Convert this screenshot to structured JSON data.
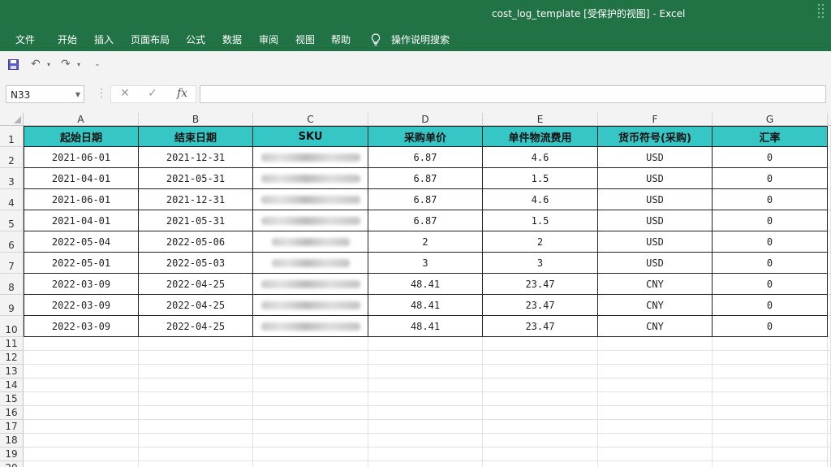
{
  "window": {
    "title": "cost_log_template  [受保护的视图]  -  Excel"
  },
  "menu": [
    "文件",
    "开始",
    "插入",
    "页面布局",
    "公式",
    "数据",
    "审阅",
    "视图",
    "帮助"
  ],
  "search": {
    "label": "操作说明搜索"
  },
  "name_box": {
    "value": "N33"
  },
  "formula_bar": {
    "fx": "fx",
    "value": ""
  },
  "columns": [
    "A",
    "B",
    "C",
    "D",
    "E",
    "F",
    "G"
  ],
  "row_numbers": [
    "1",
    "2",
    "3",
    "4",
    "5",
    "6",
    "7",
    "8",
    "9",
    "10",
    "11",
    "12",
    "13",
    "14",
    "15",
    "16",
    "17",
    "18",
    "19",
    "20"
  ],
  "table": {
    "headers": [
      "起始日期",
      "结束日期",
      "SKU",
      "采购单价",
      "单件物流费用",
      "货币符号(采购)",
      "汇率"
    ],
    "rows": [
      [
        "2021-06-01",
        "2021-12-31",
        "",
        "6.87",
        "4.6",
        "USD",
        "0"
      ],
      [
        "2021-04-01",
        "2021-05-31",
        "",
        "6.87",
        "1.5",
        "USD",
        "0"
      ],
      [
        "2021-06-01",
        "2021-12-31",
        "",
        "6.87",
        "4.6",
        "USD",
        "0"
      ],
      [
        "2021-04-01",
        "2021-05-31",
        "",
        "6.87",
        "1.5",
        "USD",
        "0"
      ],
      [
        "2022-05-04",
        "2022-05-06",
        "",
        "2",
        "2",
        "USD",
        "0"
      ],
      [
        "2022-05-01",
        "2022-05-03",
        "",
        "3",
        "3",
        "USD",
        "0"
      ],
      [
        "2022-03-09",
        "2022-04-25",
        "",
        "48.41",
        "23.47",
        "CNY",
        "0"
      ],
      [
        "2022-03-09",
        "2022-04-25",
        "",
        "48.41",
        "23.47",
        "CNY",
        "0"
      ],
      [
        "2022-03-09",
        "2022-04-25",
        "",
        "48.41",
        "23.47",
        "CNY",
        "0"
      ]
    ]
  },
  "colors": {
    "title_bar": "#217346",
    "header_fill": "#36c6c6"
  }
}
